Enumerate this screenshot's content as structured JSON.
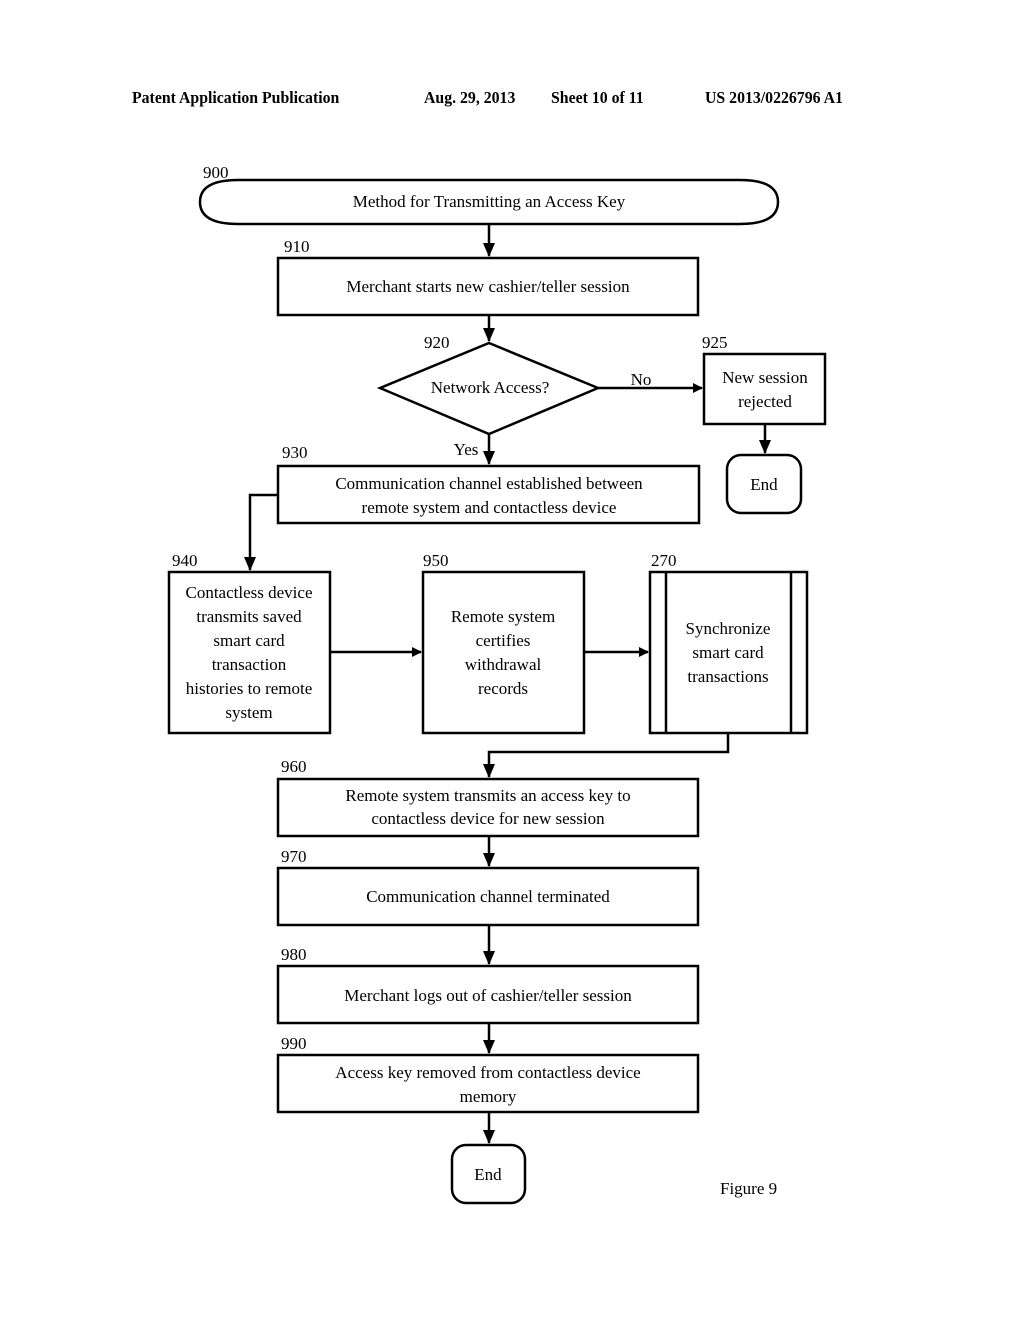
{
  "header": {
    "publication": "Patent Application Publication",
    "date": "Aug. 29, 2013",
    "sheet": "Sheet 10 of 11",
    "patent_number": "US 2013/0226796 A1"
  },
  "figure_label": "Figure 9",
  "flowchart": {
    "start": {
      "ref": "900",
      "text": "Method for Transmitting an Access Key"
    },
    "steps": {
      "s910": {
        "ref": "910",
        "lines": [
          "Merchant starts new cashier/teller session"
        ]
      },
      "s920": {
        "ref": "920",
        "lines": [
          "Network Access?"
        ],
        "yes": "Yes",
        "no": "No"
      },
      "s925": {
        "ref": "925",
        "lines": [
          "New session",
          "rejected"
        ]
      },
      "end1": {
        "text": "End"
      },
      "s930": {
        "ref": "930",
        "lines": [
          "Communication channel established between",
          "remote system and contactless device"
        ]
      },
      "s940": {
        "ref": "940",
        "lines": [
          "Contactless device",
          "transmits saved",
          "smart card",
          "transaction",
          "histories to remote",
          "system"
        ]
      },
      "s950": {
        "ref": "950",
        "lines": [
          "Remote system",
          "certifies",
          "withdrawal",
          "records"
        ]
      },
      "s270": {
        "ref": "270",
        "lines": [
          "Synchronize",
          "smart card",
          "transactions"
        ]
      },
      "s960": {
        "ref": "960",
        "lines": [
          "Remote system transmits an access key to",
          "contactless device for new session"
        ]
      },
      "s970": {
        "ref": "970",
        "lines": [
          "Communication channel terminated"
        ]
      },
      "s980": {
        "ref": "980",
        "lines": [
          "Merchant logs out of cashier/teller session"
        ]
      },
      "s990": {
        "ref": "990",
        "lines": [
          "Access key removed from contactless device",
          "memory"
        ]
      },
      "end2": {
        "text": "End"
      }
    }
  }
}
